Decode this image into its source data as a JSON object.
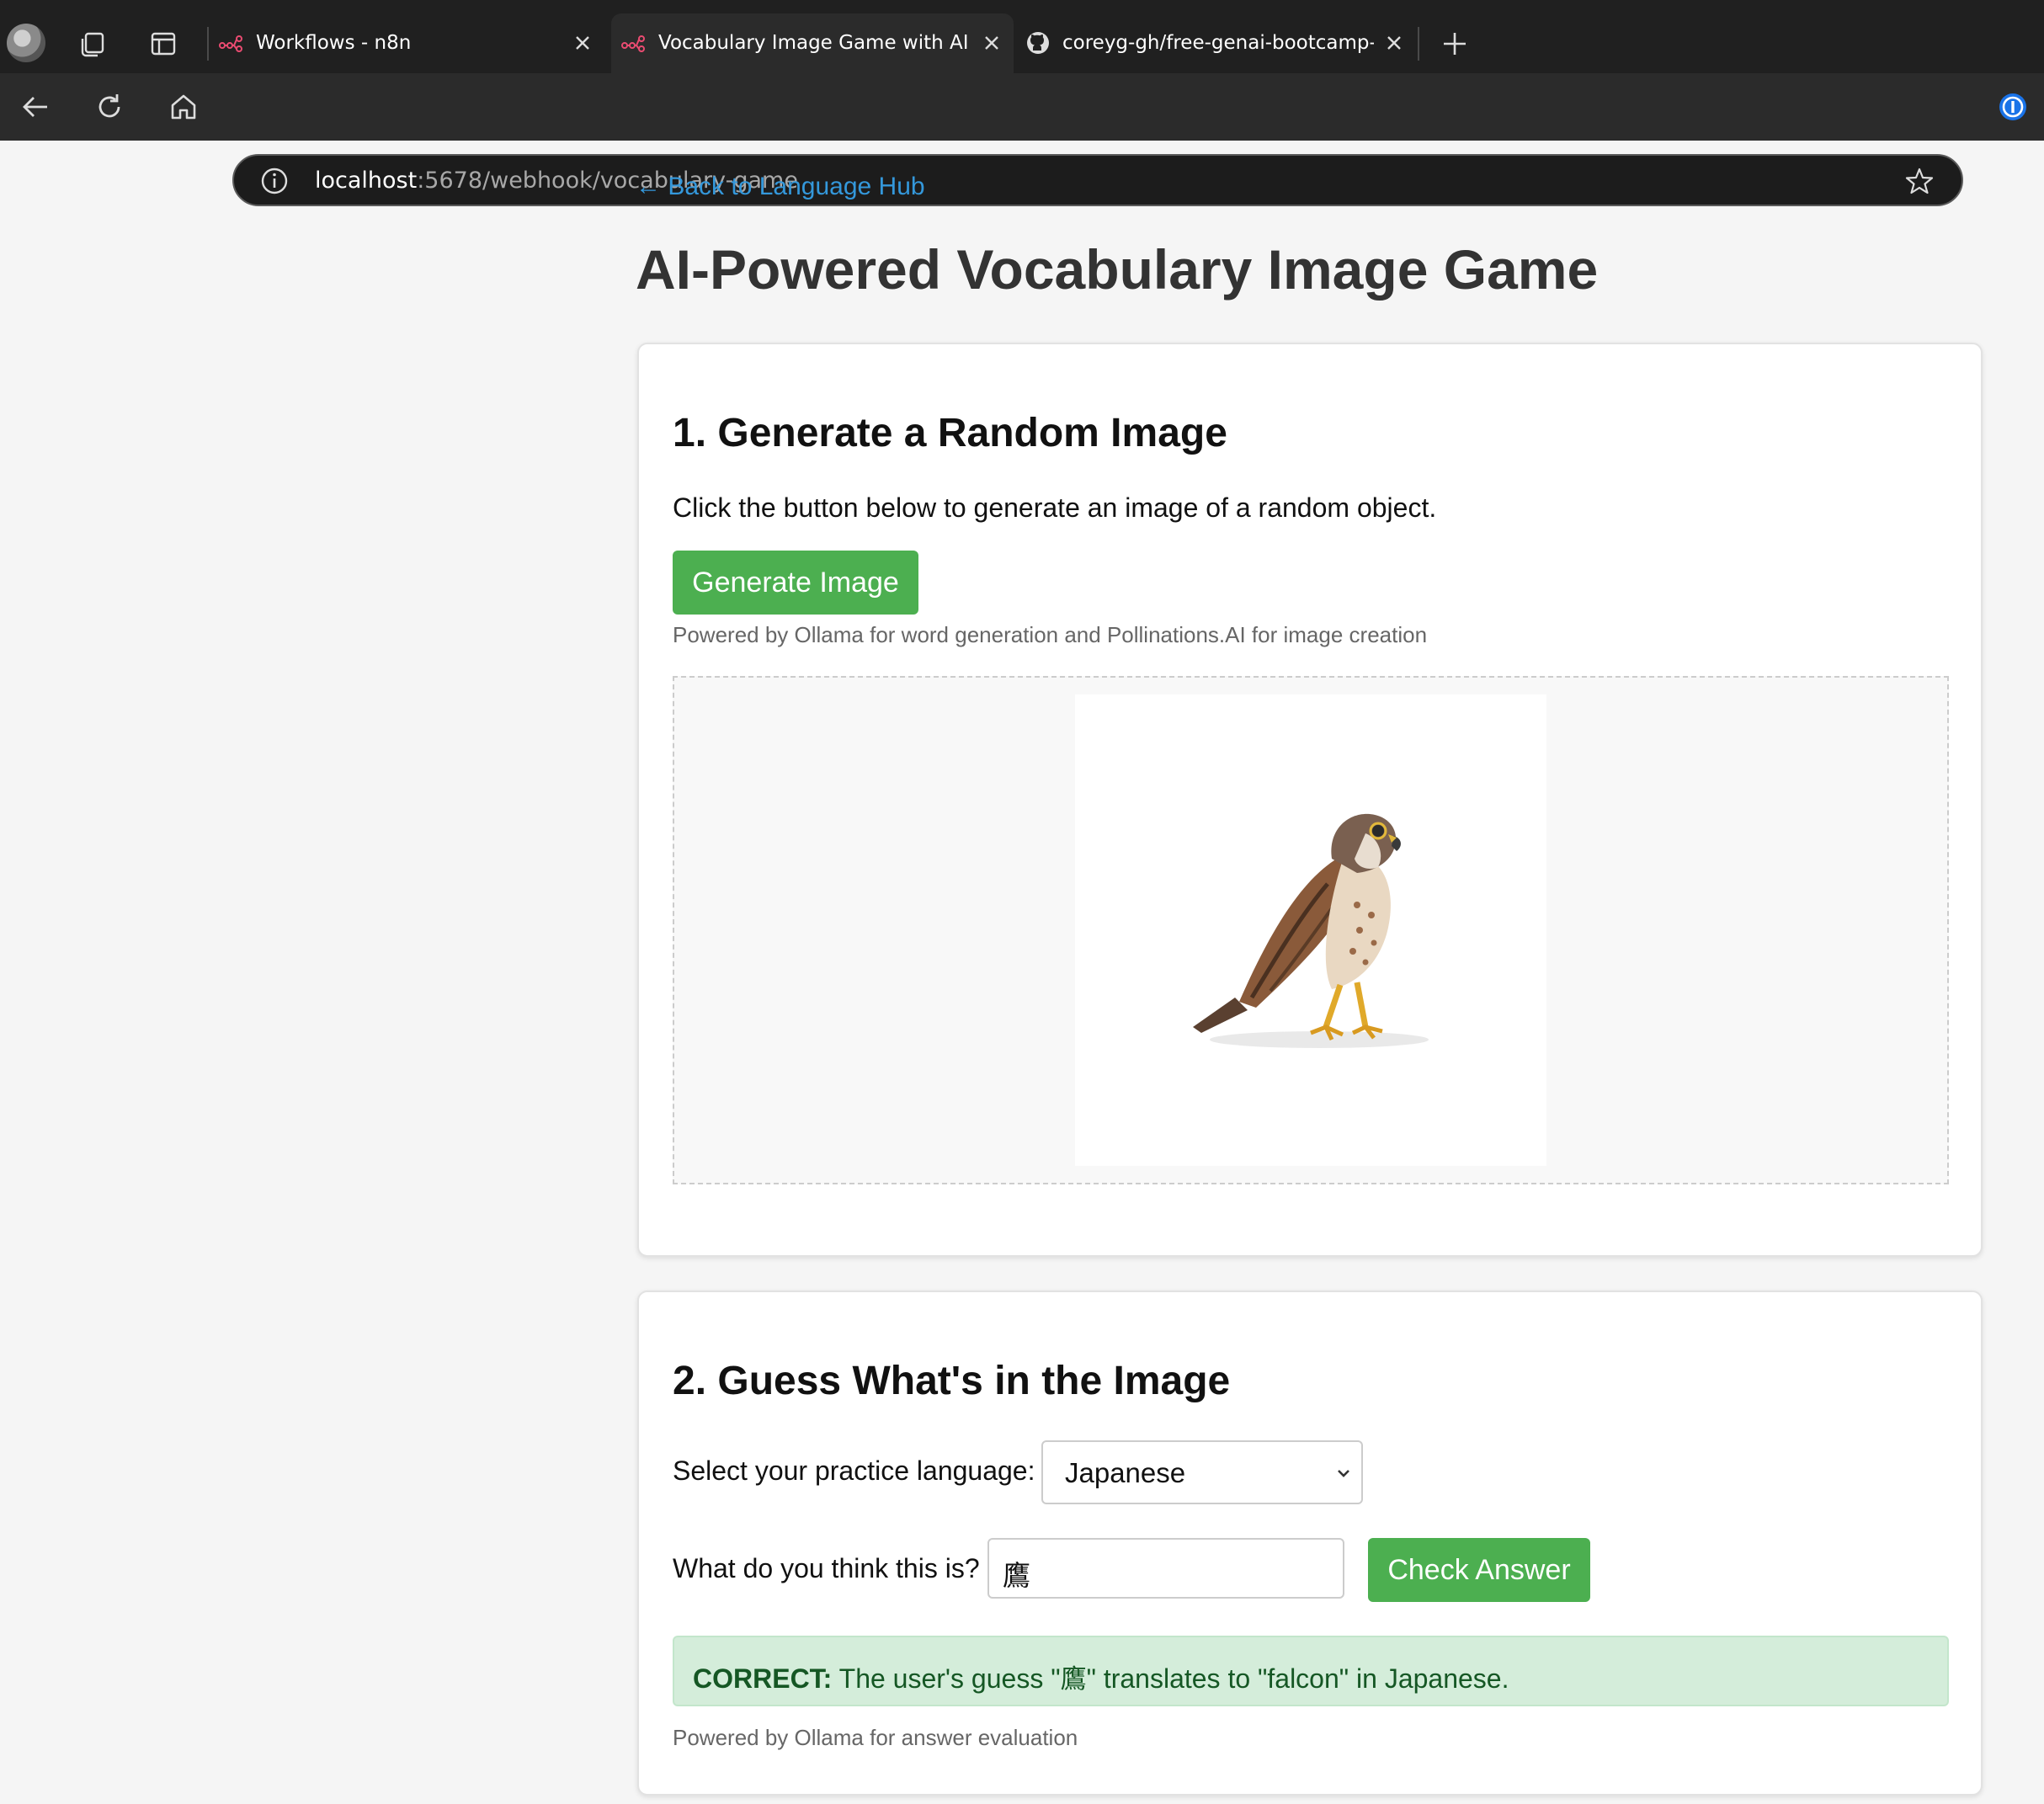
{
  "browser": {
    "tabs": [
      {
        "title": "Workflows - n8n",
        "active": false
      },
      {
        "title": "Vocabulary Image Game with AI",
        "active": true
      },
      {
        "title": "coreyg-gh/free-genai-bootcamp-",
        "active": false
      }
    ],
    "url_host": "localhost",
    "url_rest": ":5678/webhook/vocabulary-game",
    "icons": [
      "profile-avatar",
      "collections-icon",
      "tab-actions-icon",
      "n8n-icon",
      "github-icon",
      "close-icon",
      "new-tab-icon",
      "back-icon",
      "refresh-icon",
      "home-icon",
      "site-info-icon",
      "favorite-star-icon",
      "password-manager-icon"
    ]
  },
  "page": {
    "back_link": "← Back to Language Hub",
    "title": "AI-Powered Vocabulary Image Game",
    "section1": {
      "heading": "1. Generate a Random Image",
      "description": "Click the button below to generate an image of a random object.",
      "button": "Generate Image",
      "note": "Powered by Ollama for word generation and Pollinations.AI for image creation",
      "image_alt": "falcon"
    },
    "section2": {
      "heading": "2. Guess What's in the Image",
      "language_label": "Select your practice language:",
      "language_selected": "Japanese",
      "guess_label": "What do you think this is?",
      "guess_value": "鷹",
      "check_button": "Check Answer",
      "result_status": "CORRECT:",
      "result_prefix": " The user's guess \"",
      "result_guess": "鷹",
      "result_suffix": "\" translates to \"falcon\" in Japanese.",
      "note": "Powered by Ollama for answer evaluation"
    }
  },
  "colors": {
    "accent_green": "#4caf50",
    "link_blue": "#3498db",
    "success_bg": "#d4edda",
    "success_text": "#155724"
  }
}
